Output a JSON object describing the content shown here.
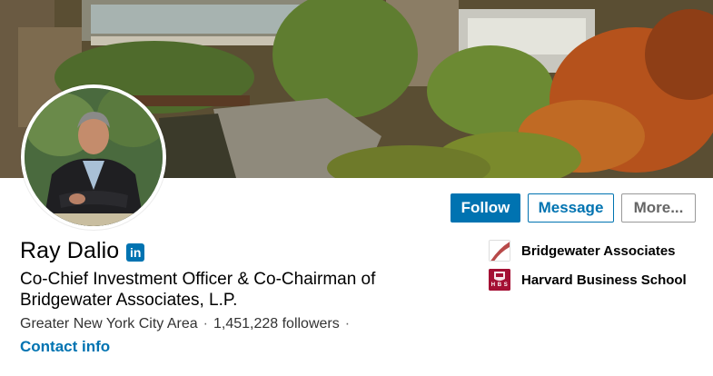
{
  "profile": {
    "name": "Ray Dalio",
    "headline": "Co-Chief Investment Officer & Co-Chairman of Bridgewater Associates, L.P.",
    "location": "Greater New York City Area",
    "separator": "·",
    "followers": "1,451,228 followers",
    "contact_info": "Contact info",
    "in_badge": "in"
  },
  "actions": {
    "follow": "Follow",
    "message": "Message",
    "more": "More..."
  },
  "orgs": [
    {
      "name": "Bridgewater Associates",
      "logo": "bridgewater-logo"
    },
    {
      "name": "Harvard Business School",
      "logo": "hbs-shield-logo",
      "logo_text": "H B S"
    }
  ],
  "colors": {
    "accent": "#0073b1",
    "hbs": "#a41034"
  }
}
